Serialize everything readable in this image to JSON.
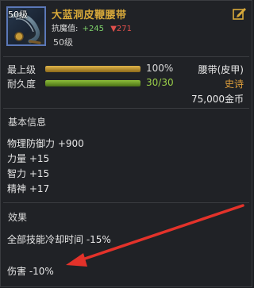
{
  "item": {
    "level_badge": "50级",
    "name": "大蓝洞皮鞭腰带",
    "stat_label": "抗魔值:",
    "stat_plus": "+245",
    "stat_minus": "▼271",
    "required_level": "50级"
  },
  "bars": {
    "max_level": {
      "label": "最上级",
      "value_text": "100%",
      "fraction": 1.0,
      "right": "腰带(皮甲)"
    },
    "durability": {
      "label": "耐久度",
      "value_text": "30/30",
      "fraction": 1.0,
      "right": "史诗"
    }
  },
  "price": "75,000金币",
  "basic_info": {
    "title": "基本信息",
    "stats": [
      "物理防御力 +900",
      "力量 +15",
      "智力 +15",
      "精神 +17"
    ]
  },
  "effects": {
    "title": "效果",
    "lines": [
      "全部技能冷却时间 -15%",
      "伤害 -10%"
    ]
  },
  "colors": {
    "item_name": "#d8a93a",
    "epic": "#e0a03c",
    "value_plus": "#7fd36b",
    "value_minus": "#e0504c",
    "annotation_arrow": "#e3322a"
  },
  "icons": {
    "item": "whip-belt-icon",
    "edit": "edit-icon",
    "annotation": "red-arrow-annotation"
  }
}
